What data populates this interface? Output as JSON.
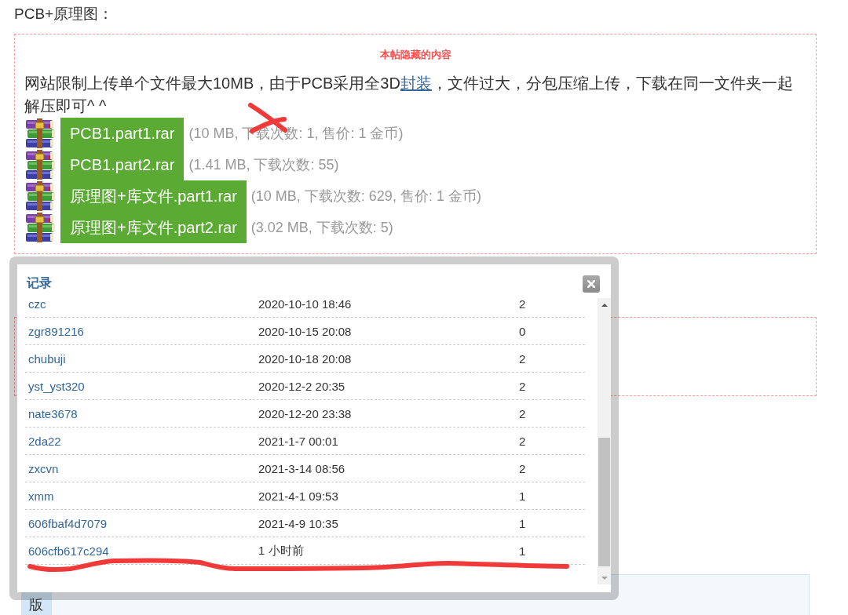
{
  "heading": "PCB+原理图：",
  "hidden_box": {
    "title": "本帖隐藏的内容",
    "notice": [
      {
        "kind": "text",
        "text": "网站限制上传单个文件最大10MB，由于PCB采用全3D"
      },
      {
        "kind": "link",
        "text": "封装"
      },
      {
        "kind": "text",
        "text": "，文件过大，分包压缩上传，下载在同一文件夹一起解压即可^ ^"
      }
    ],
    "attachments": [
      {
        "name": "PCB1.part1.rar",
        "info": "(10 MB, 下载次数: 1, 售价: 1 金币)"
      },
      {
        "name": "PCB1.part2.rar",
        "info": "(1.41 MB, 下载次数: 55)"
      },
      {
        "name": "原理图+库文件.part1.rar",
        "info": "(10 MB, 下载次数: 629, 售价: 1 金币)"
      },
      {
        "name": "原理图+库文件.part2.rar",
        "info": "(3.02 MB, 下载次数: 5)"
      }
    ]
  },
  "dialog": {
    "title": "记录",
    "rows": [
      {
        "user": "czc",
        "time": "2020-10-10 18:46",
        "count": "2"
      },
      {
        "user": "zgr891216",
        "time": "2020-10-15 20:08",
        "count": "0"
      },
      {
        "user": "chubuji",
        "time": "2020-10-18 20:08",
        "count": "2"
      },
      {
        "user": "yst_yst320",
        "time": "2020-12-2 20:35",
        "count": "2"
      },
      {
        "user": "nate3678",
        "time": "2020-12-20 23:38",
        "count": "2"
      },
      {
        "user": "2da22",
        "time": "2021-1-7 00:01",
        "count": "2"
      },
      {
        "user": "zxcvn",
        "time": "2021-3-14 08:56",
        "count": "2"
      },
      {
        "user": "xmm",
        "time": "2021-4-1 09:53",
        "count": "1"
      },
      {
        "user": "606fbaf4d7079",
        "time": "2021-4-9 10:35",
        "count": "1"
      },
      {
        "user": "606cfb617c294",
        "time": "1 小时前",
        "count": "1"
      }
    ]
  },
  "bottom_tab": {
    "label": "版"
  }
}
